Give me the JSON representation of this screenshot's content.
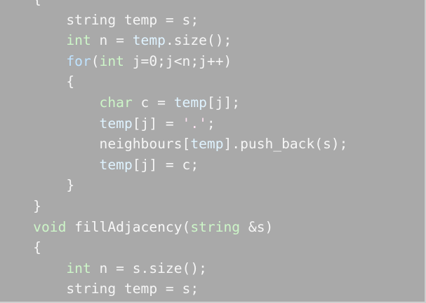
{
  "lines": [
    [
      {
        "c": "pl",
        "t": "    {"
      }
    ],
    [
      {
        "c": "pl",
        "t": "        string temp = s;"
      }
    ],
    [
      {
        "c": "ty",
        "t": "        int"
      },
      {
        "c": "pl",
        "t": " n = "
      },
      {
        "c": "id",
        "t": "temp"
      },
      {
        "c": "pl",
        "t": ".size();"
      }
    ],
    [
      {
        "c": "kw",
        "t": "        for"
      },
      {
        "c": "pl",
        "t": "("
      },
      {
        "c": "ty",
        "t": "int"
      },
      {
        "c": "pl",
        "t": " j=0;j<n;j++)"
      }
    ],
    [
      {
        "c": "pl",
        "t": "        {"
      }
    ],
    [
      {
        "c": "ty",
        "t": "            char"
      },
      {
        "c": "pl",
        "t": " c = "
      },
      {
        "c": "id",
        "t": "temp"
      },
      {
        "c": "pl",
        "t": "[j];"
      }
    ],
    [
      {
        "c": "id",
        "t": "            temp"
      },
      {
        "c": "pl",
        "t": "[j] = "
      },
      {
        "c": "str",
        "t": "'.'"
      },
      {
        "c": "pl",
        "t": ";"
      }
    ],
    [
      {
        "c": "pl",
        "t": "            neighbours["
      },
      {
        "c": "id",
        "t": "temp"
      },
      {
        "c": "pl",
        "t": "].push_back(s);"
      }
    ],
    [
      {
        "c": "id",
        "t": "            temp"
      },
      {
        "c": "pl",
        "t": "[j] = c;"
      }
    ],
    [
      {
        "c": "pl",
        "t": "        }"
      }
    ],
    [
      {
        "c": "pl",
        "t": "    }"
      }
    ],
    [
      {
        "c": "ty",
        "t": "    void"
      },
      {
        "c": "pl",
        "t": " "
      },
      {
        "c": "fn",
        "t": "fillAdjacency"
      },
      {
        "c": "pl",
        "t": "("
      },
      {
        "c": "ty",
        "t": "string"
      },
      {
        "c": "pl",
        "t": " &s)"
      }
    ],
    [
      {
        "c": "pl",
        "t": "    {"
      }
    ],
    [
      {
        "c": "ty",
        "t": "        int"
      },
      {
        "c": "pl",
        "t": " n = s.size();"
      }
    ],
    [
      {
        "c": "pl",
        "t": "        string temp = s;"
      }
    ]
  ]
}
